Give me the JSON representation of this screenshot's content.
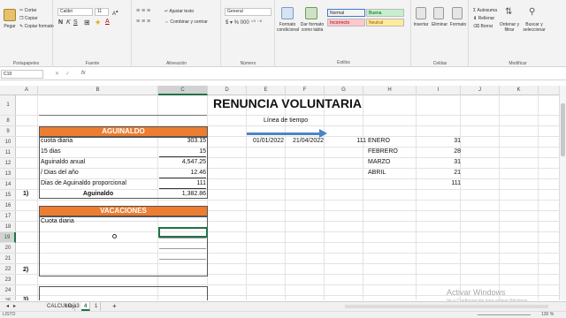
{
  "ribbon": {
    "clipboard": {
      "paste": "Pegar",
      "cut": "Cortar",
      "copy": "Copiar",
      "format_painter": "Copiar formato",
      "group": "Portapapeles"
    },
    "font": {
      "name": "Calibri",
      "size": "11",
      "group": "Fuente"
    },
    "alignment": {
      "wrap": "Ajustar texto",
      "merge": "Combinar y centrar",
      "group": "Alineación"
    },
    "number": {
      "format": "General",
      "group": "Número"
    },
    "styles": {
      "conditional": "Formato condicional",
      "as_table": "Dar formato como tabla",
      "cells": [
        {
          "label": "Normal",
          "bg": "#ffffff",
          "fg": "#000000"
        },
        {
          "label": "Buena",
          "bg": "#c6efce",
          "fg": "#006100"
        },
        {
          "label": "Incorrecto",
          "bg": "#ffc7ce",
          "fg": "#9c0006"
        },
        {
          "label": "Neutral",
          "bg": "#ffeb9c",
          "fg": "#9c5700"
        }
      ]
    },
    "cells_group": {
      "insert": "Insertar",
      "delete": "Eliminar",
      "format": "Formato",
      "group": "Celdas"
    },
    "editing": {
      "autosum": "Autosuma",
      "fill": "Rellenar",
      "clear": "Borrar",
      "sort": "Ordenar y filtrar",
      "find": "Buscar y seleccionar",
      "group": "Modificar"
    }
  },
  "formula_bar": {
    "name_box": "C19",
    "fx": "fx",
    "cancel": "✕",
    "confirm": "✓",
    "formula": ""
  },
  "columns": [
    "A",
    "B",
    "C",
    "D",
    "E",
    "F",
    "G",
    "H",
    "I",
    "J",
    "K"
  ],
  "selected_column": "C",
  "rows": [
    "1",
    "8",
    "9",
    "10",
    "11",
    "12",
    "13",
    "14",
    "15",
    "16",
    "17",
    "18",
    "19",
    "20",
    "21",
    "22",
    "23",
    "24",
    "25"
  ],
  "selected_row": "19",
  "sheet": {
    "title": "RENUNCIA VOLUNTARIA",
    "timeline_label": "Línea de tiempo",
    "date_start": "01/01/2022",
    "date_end": "21/04/2022",
    "total_days": "111",
    "aguinaldo": {
      "header": "AGUINALDO",
      "rows": [
        {
          "label": "cuota diaria",
          "value": "303.15"
        },
        {
          "label": "15 dias",
          "value": "15"
        },
        {
          "label": "Aguinaldo anual",
          "value": "4,547.25"
        },
        {
          "label": "/ Dias del año",
          "value": "12.46"
        },
        {
          "label": "Dias de Aguinaldo proporcional",
          "value": "111"
        }
      ],
      "total_label": "Aguinaldo",
      "total_value": "1,382.86",
      "marker": "1)"
    },
    "vacaciones": {
      "header": "VACACIONES",
      "first_label": "Cuota diaria",
      "marker": "2)"
    },
    "marker3": "3)",
    "months": [
      {
        "name": "ENERO",
        "days": "31"
      },
      {
        "name": "FEBRERO",
        "days": "28"
      },
      {
        "name": "MARZO",
        "days": "31"
      },
      {
        "name": "ABRIL",
        "days": "21"
      }
    ],
    "months_total": "111",
    "arrow_color": "#4a86c5",
    "accent_orange": "#ed7d31"
  },
  "tabs": {
    "items": [
      "CALCULO",
      "Hoja3",
      "4",
      "1"
    ],
    "active": "4",
    "add": "+"
  },
  "status": {
    "ready": "LISTO",
    "zoom": "130 %"
  },
  "watermark": {
    "title": "Activar Windows",
    "subtitle": "Ve a Configuración para activar Windows."
  }
}
